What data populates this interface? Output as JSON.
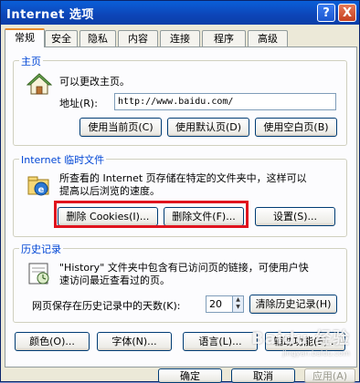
{
  "window": {
    "title": "Internet 选项",
    "help_label": "?",
    "close_label": "X"
  },
  "tabs": [
    {
      "label": "常规",
      "active": true
    },
    {
      "label": "安全",
      "active": false
    },
    {
      "label": "隐私",
      "active": false
    },
    {
      "label": "内容",
      "active": false
    },
    {
      "label": "连接",
      "active": false
    },
    {
      "label": "程序",
      "active": false
    },
    {
      "label": "高级",
      "active": false
    }
  ],
  "homepage": {
    "group_label": "主页",
    "description": "可以更改主页。",
    "address_label": "地址(R):",
    "address_value": "http://www.baidu.com/",
    "use_current": "使用当前页(C)",
    "use_default": "使用默认页(D)",
    "use_blank": "使用空白页(B)"
  },
  "temp_files": {
    "group_label": "Internet 临时文件",
    "description_line1": "所查看的 Internet 页存储在特定的文件夹中，这样可以",
    "description_line2": "提高以后浏览的速度。",
    "delete_cookies": "删除 Cookies(I)...",
    "delete_files": "删除文件(F)...",
    "settings": "设置(S)..."
  },
  "history": {
    "group_label": "历史记录",
    "description_line1": "\"History\" 文件夹中包含有已访问页的链接，可使用户快",
    "description_line2": "速访问最近查看过的页。",
    "days_label": "网页保存在历史记录中的天数(K):",
    "days_value": "20",
    "clear_history": "清除历史记录(H)"
  },
  "bottom_row": {
    "colors": "颜色(O)...",
    "fonts": "字体(N)...",
    "languages": "语言(L)...",
    "accessibility": "辅助功能(E)..."
  },
  "dialog_buttons": {
    "ok": "确定",
    "cancel": "取消",
    "apply": "应用(A)"
  },
  "watermark": {
    "brand": "Baidu 经验",
    "url": "jingyan.baidu.com"
  },
  "colors": {
    "title_bar": "#0a4fd0",
    "highlight": "#e0141e",
    "group_label": "#0046d5"
  }
}
